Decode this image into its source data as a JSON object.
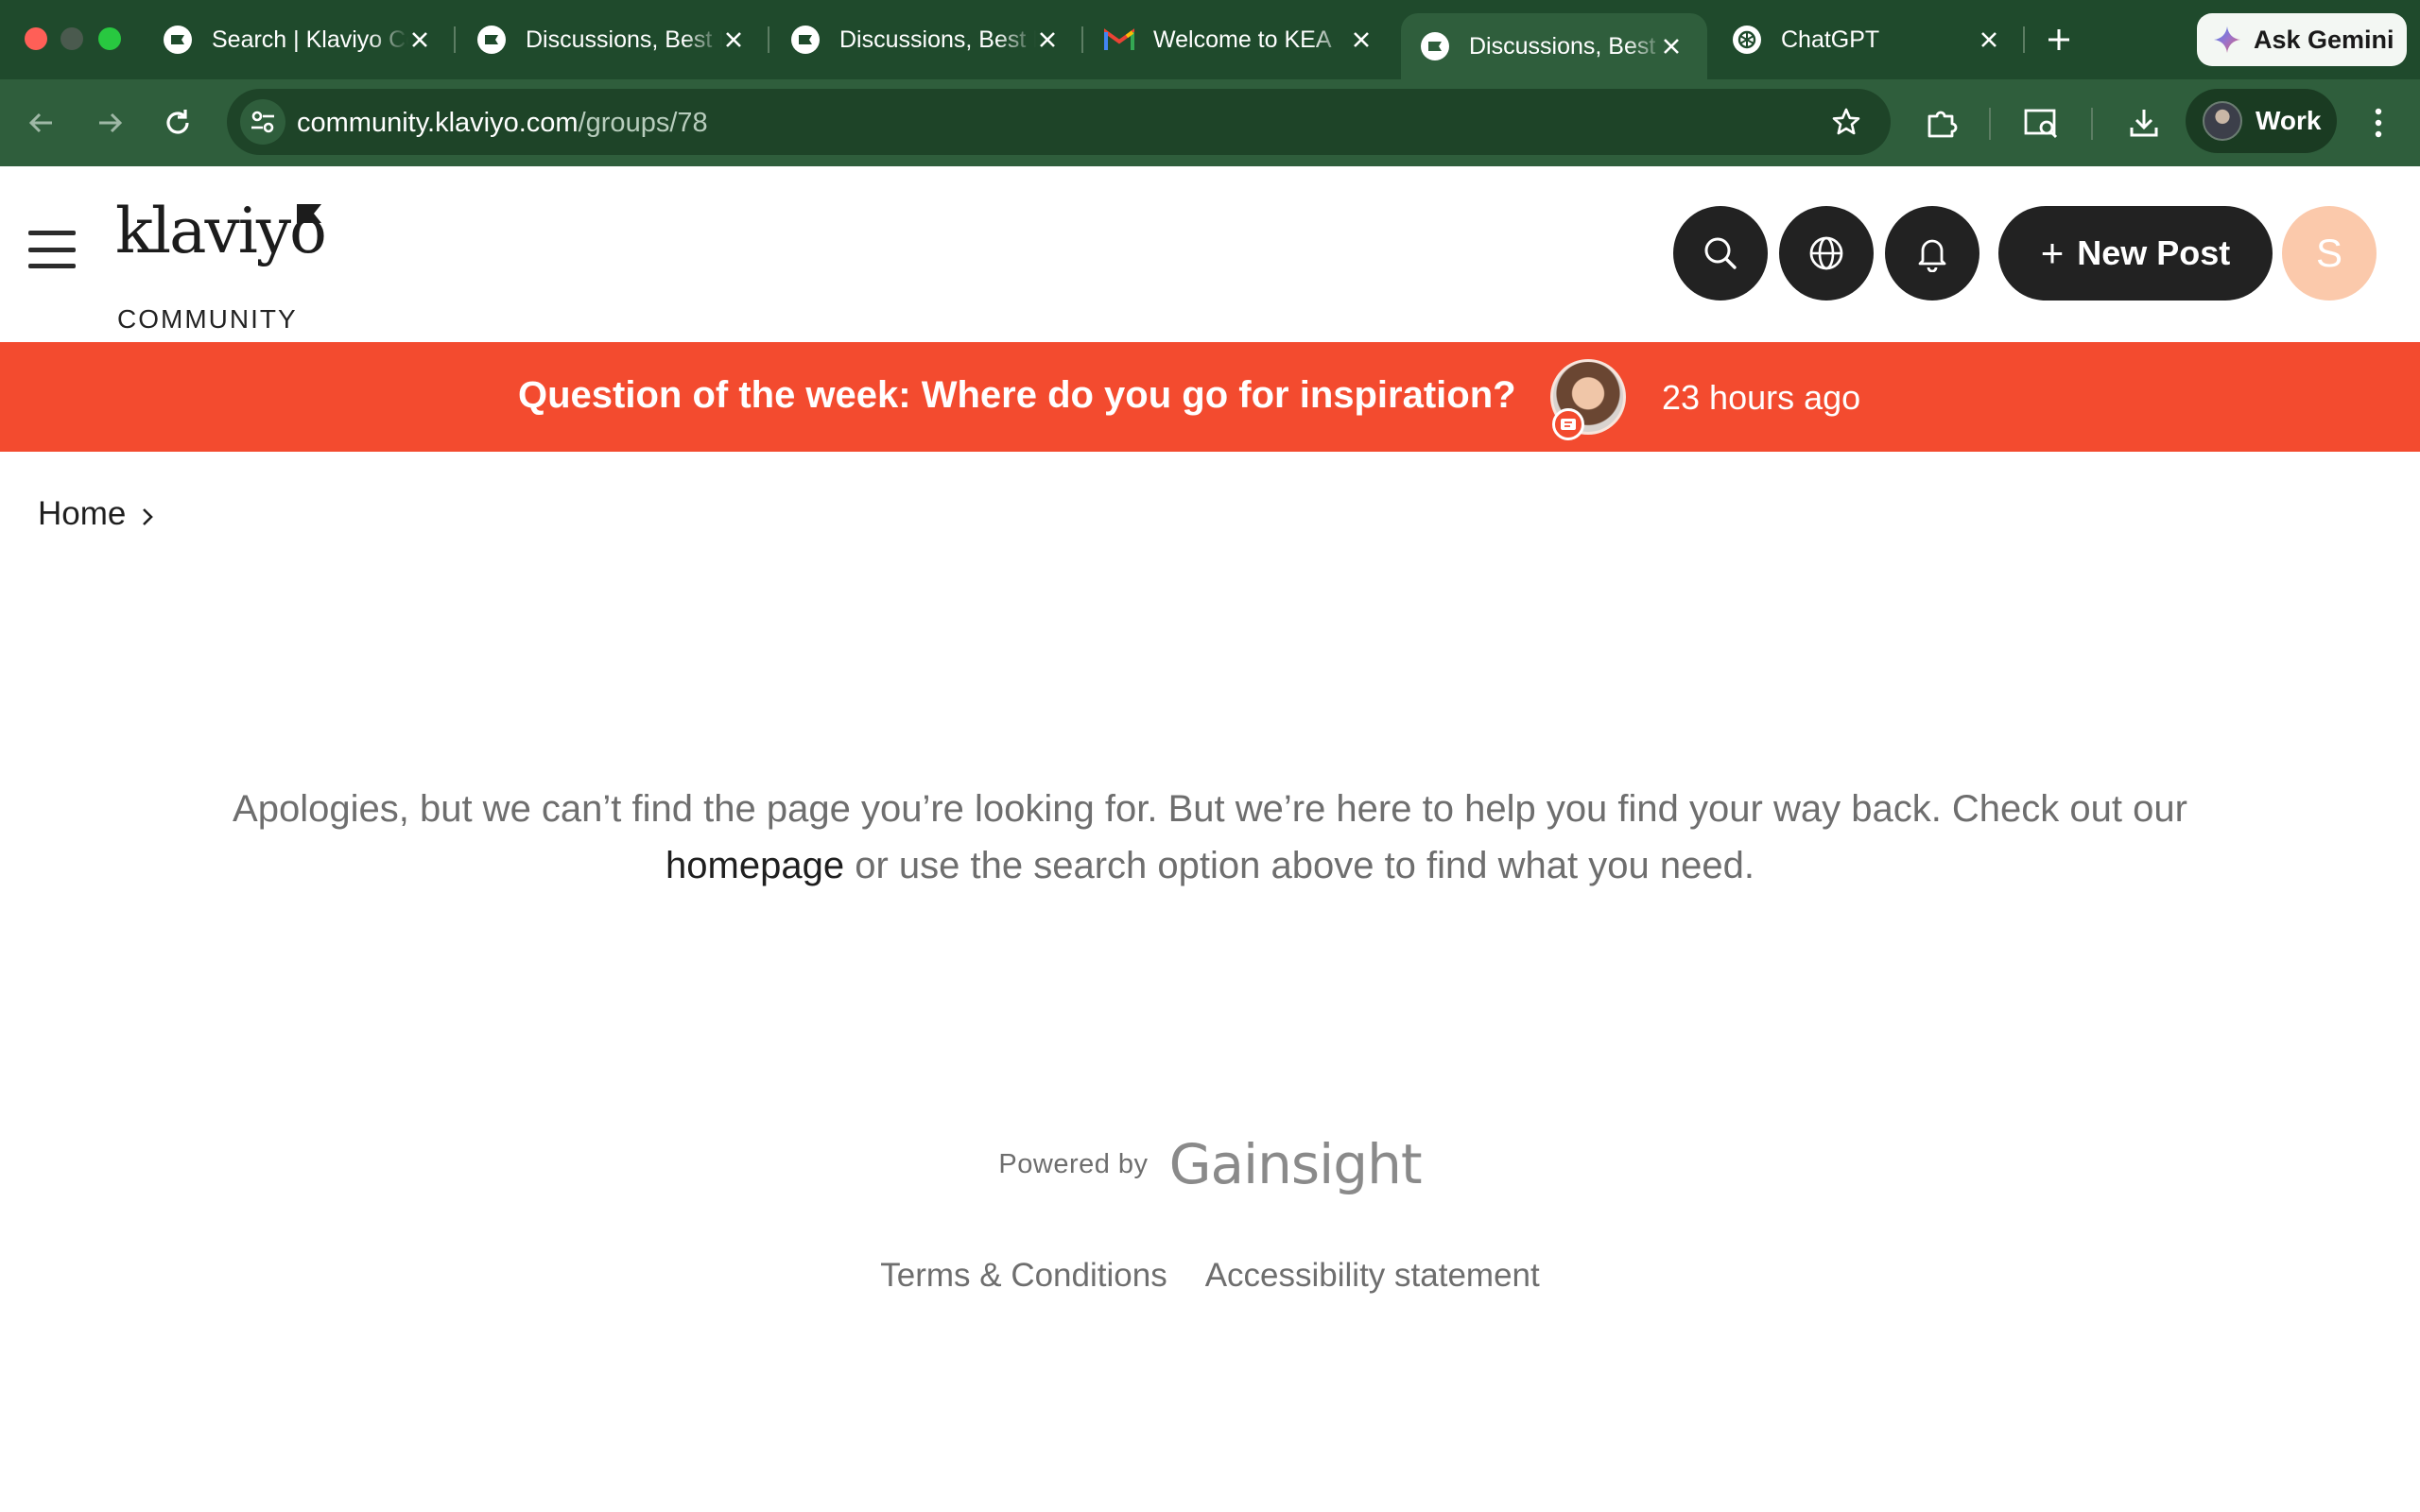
{
  "browser": {
    "tabs": [
      {
        "title": "Search | Klaviyo Community",
        "favicon": "klaviyo-icon",
        "active": false
      },
      {
        "title": "Discussions, Best Practices",
        "favicon": "klaviyo-icon",
        "active": false
      },
      {
        "title": "Discussions, Best Practices",
        "favicon": "klaviyo-icon",
        "active": false
      },
      {
        "title": "Welcome to KEA",
        "favicon": "gmail-icon",
        "active": false
      },
      {
        "title": "Discussions, Best Practices",
        "favicon": "klaviyo-icon",
        "active": true
      },
      {
        "title": "ChatGPT",
        "favicon": "chatgpt-icon",
        "active": false
      }
    ],
    "gemini_label": "Ask Gemini",
    "url_host": "community.klaviyo.com",
    "url_path": "/groups/78",
    "profile_label": "Work"
  },
  "site": {
    "logo_text": "klaviyo",
    "logo_sub": "COMMUNITY",
    "new_post_label": "New Post",
    "avatar_initial": "S",
    "accent_color": "#f34b2f"
  },
  "banner": {
    "text": "Question of the week: Where do you go for inspiration?",
    "time": "23 hours ago"
  },
  "breadcrumb": {
    "home": "Home"
  },
  "message": {
    "line1": "Apologies, but we can’t find the page you’re looking for. But we’re here to help you find your way back. Check out our",
    "link": "homepage",
    "line2": " or use the search option above to find what you need."
  },
  "footer": {
    "powered_by": "Powered by",
    "brand": "Gainsight",
    "links": [
      "Terms & Conditions",
      "Accessibility statement"
    ]
  }
}
